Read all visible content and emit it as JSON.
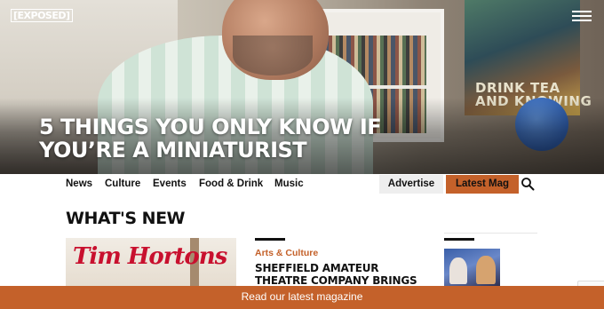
{
  "brand": {
    "logo": "[EXPOSED]"
  },
  "hero": {
    "title": "5 THINGS YOU ONLY KNOW IF YOU’RE A MINIATURIST",
    "poster_text": "DRINK TEA\nAND KNOWING"
  },
  "nav": {
    "items": [
      "News",
      "Culture",
      "Events",
      "Food & Drink",
      "Music"
    ],
    "advertise": "Advertise",
    "latest_mag": "Latest Mag"
  },
  "section": {
    "title": "WHAT'S NEW"
  },
  "cards": [
    {
      "image_text": "Tim Hortons"
    },
    {
      "category": "Arts & Culture",
      "headline": "SHEFFIELD AMATEUR THEATRE COMPANY BRINGS"
    },
    {
      "thumbnail": "photo"
    }
  ],
  "banner": {
    "text": "Read our latest magazine"
  },
  "colors": {
    "accent": "#c4612a",
    "text": "#111111",
    "advertise_bg": "#eeeeee"
  },
  "icons": {
    "menu": "hamburger-menu-icon",
    "search": "search-icon"
  }
}
